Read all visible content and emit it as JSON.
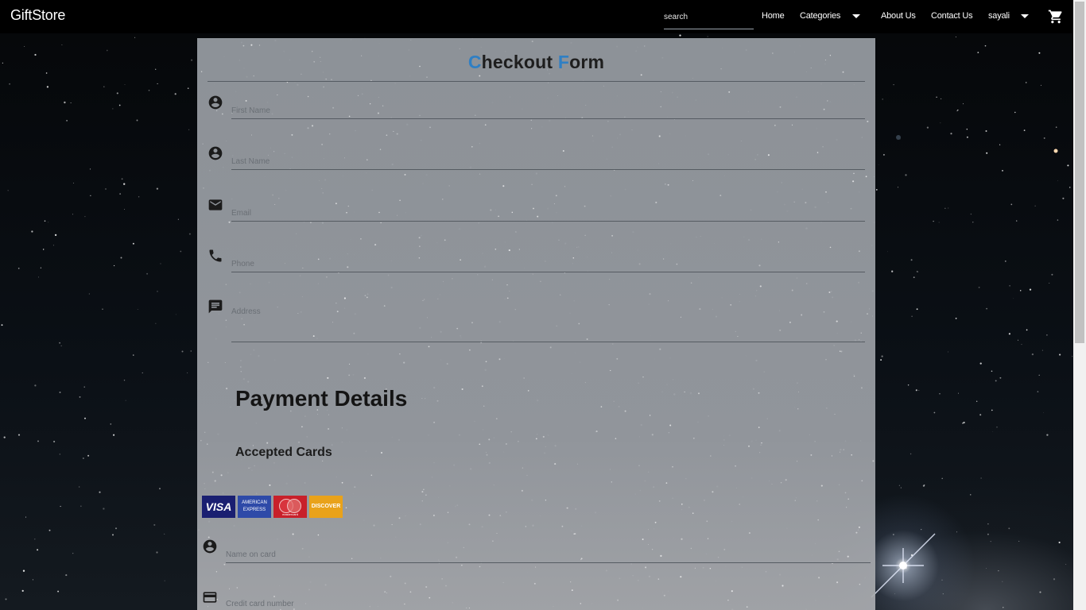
{
  "navbar": {
    "brand": "GiftStore",
    "search_placeholder": "search",
    "links": {
      "home": "Home",
      "categories": "Categories",
      "about": "About Us",
      "contact": "Contact Us",
      "user": "sayali"
    },
    "icons": {
      "cart": "shopping-cart-icon",
      "caret": "arrow-drop-down-icon"
    }
  },
  "form": {
    "title_initial_1": "C",
    "title_rest_1": "heckout ",
    "title_initial_2": "F",
    "title_rest_2": "orm",
    "accent_color": "#2f7fc4",
    "fields": {
      "first_name": "First Name",
      "last_name": "Last Name",
      "email": "Email",
      "phone": "Phone",
      "address": "Address"
    },
    "icons": {
      "first_name": "account-circle-icon",
      "last_name": "account-circle-icon",
      "email": "mail-icon",
      "phone": "phone-icon",
      "address": "message-icon"
    }
  },
  "payment": {
    "title": "Payment Details",
    "accepted_cards_title": "Accepted Cards",
    "cards": {
      "visa": "VISA",
      "amex_line1": "AMERICAN",
      "amex_line2": "EXPRESS",
      "mastercard": "mastercard",
      "discover": "DISCOVER"
    },
    "fields": {
      "name_on_card": "Name on card",
      "card_number": "Credit card number"
    },
    "icons": {
      "name_on_card": "account-circle-icon",
      "card_number": "credit-card-icon"
    }
  }
}
